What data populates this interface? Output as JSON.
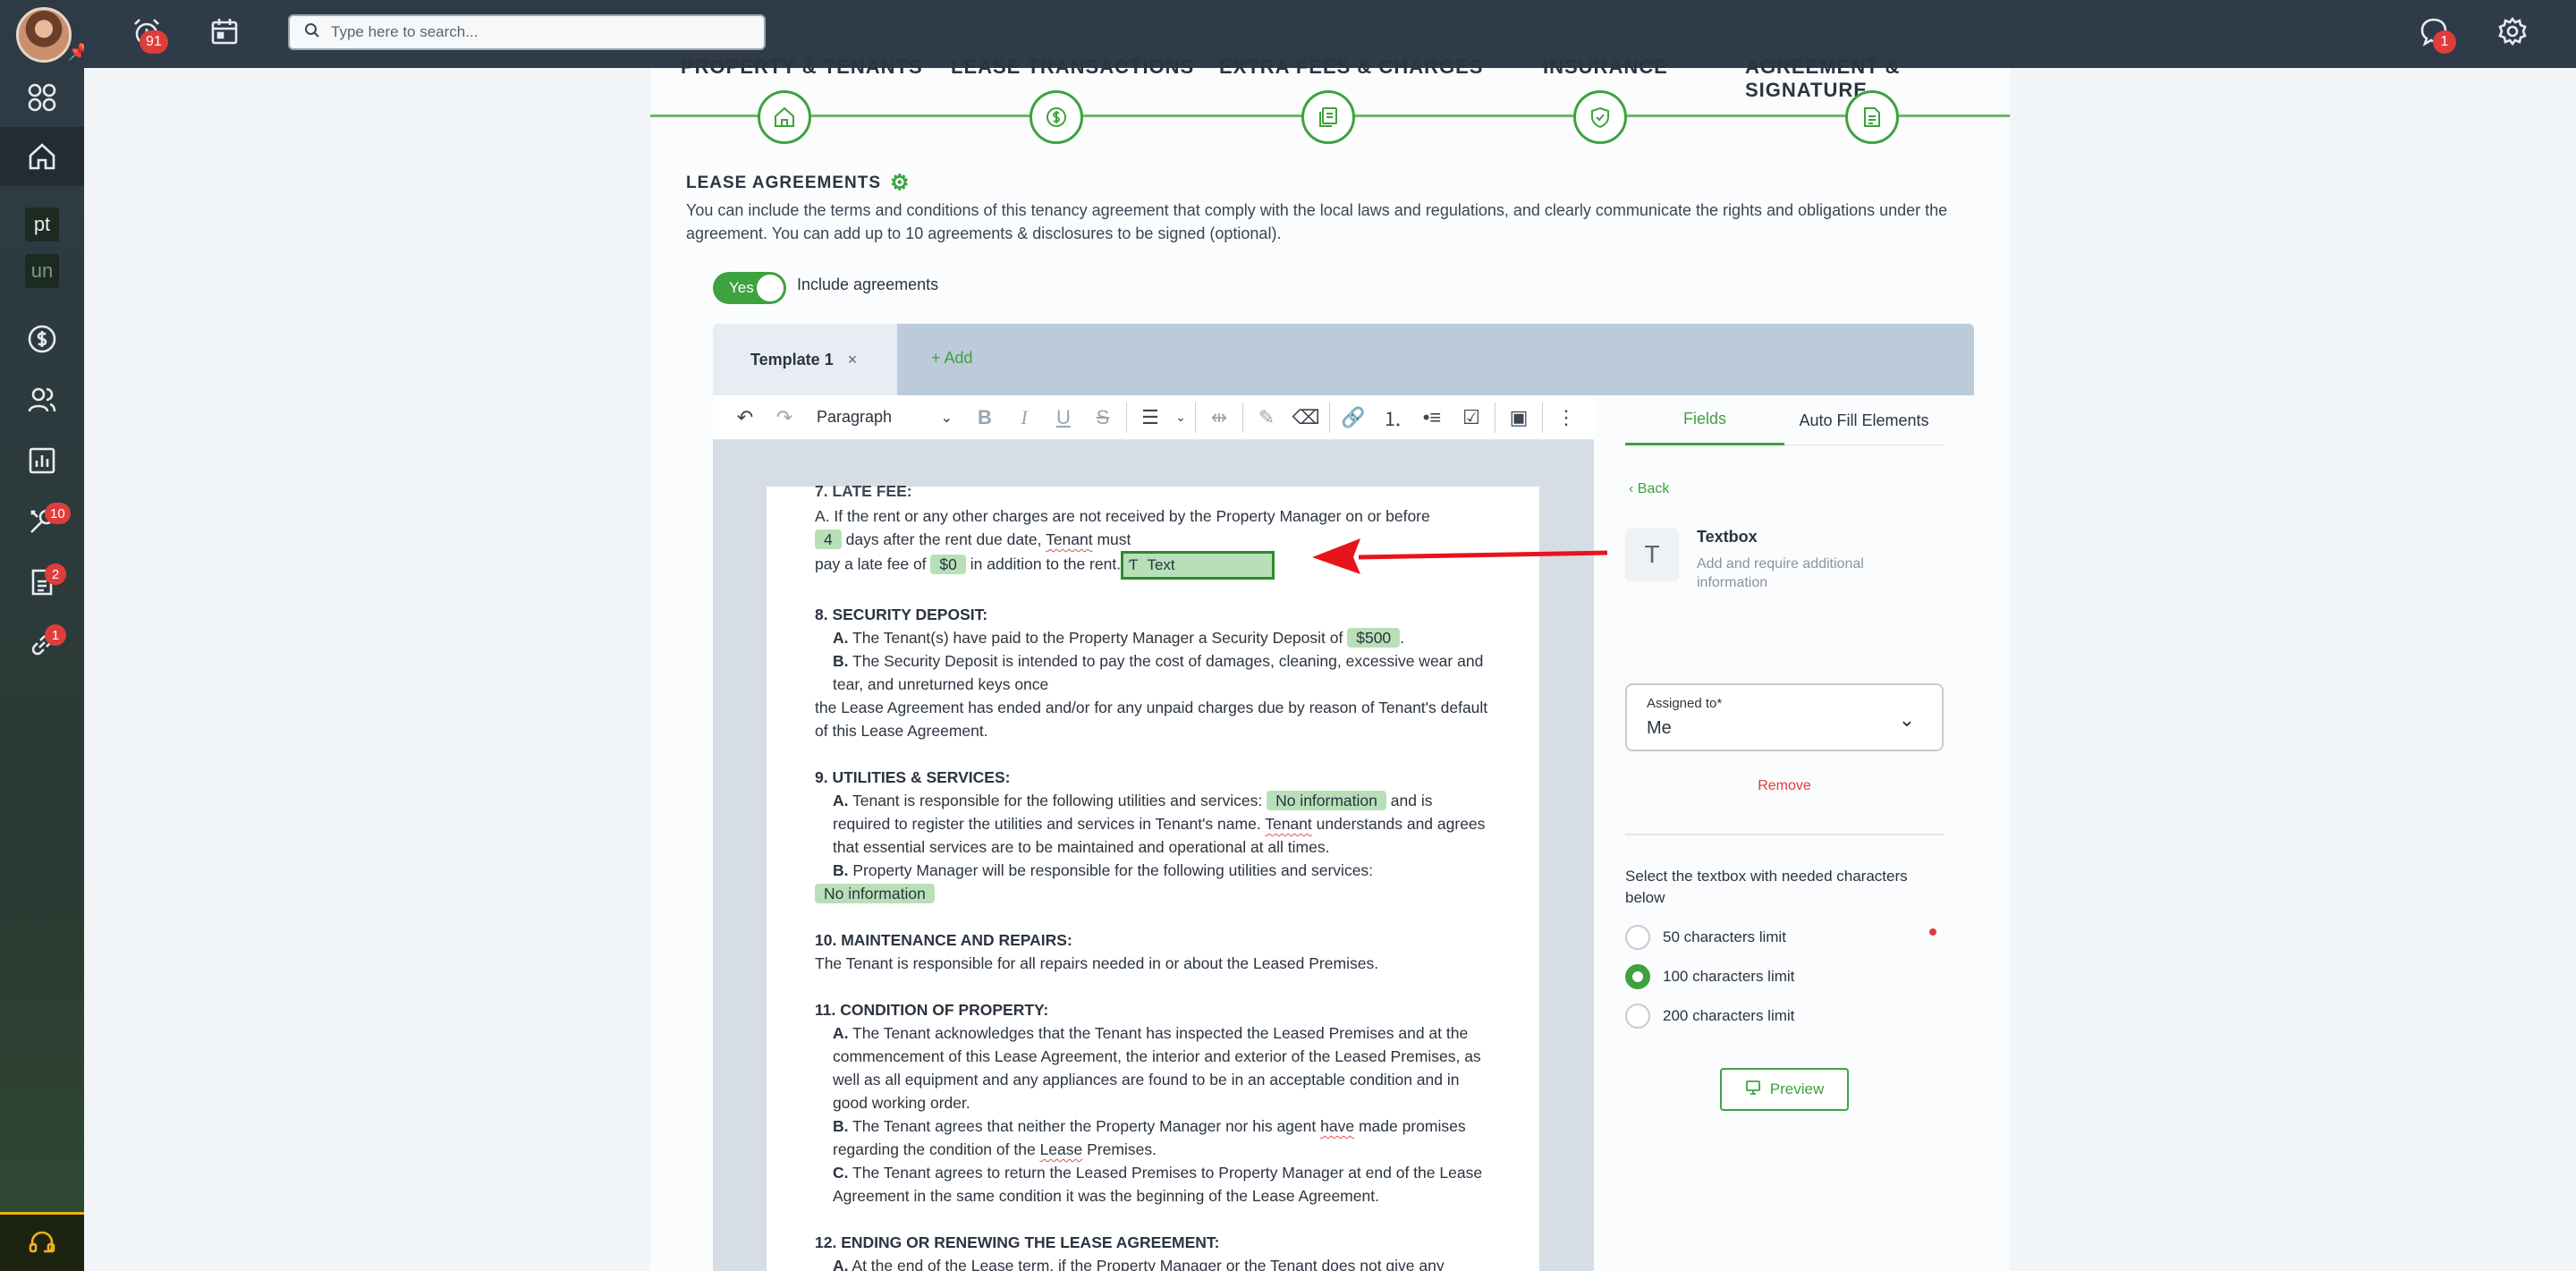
{
  "topbar": {
    "alarm_badge": "91",
    "search_placeholder": "Type here to search...",
    "chat_badge": "1"
  },
  "sidebar": {
    "square_items": [
      "pt",
      "un"
    ],
    "badges": {
      "maintenance": "10",
      "documents": "2",
      "links": "1"
    }
  },
  "stepper": {
    "labels": [
      "PROPERTY & TENANTS",
      "LEASE TRANSACTIONS",
      "EXTRA FEES & CHARGES",
      "INSURANCE",
      "AGREEMENT & SIGNATURE"
    ],
    "icons": [
      "home-icon",
      "dollar-icon",
      "copy-docs-icon",
      "shield-check-icon",
      "document-icon"
    ]
  },
  "section": {
    "title": "LEASE AGREEMENTS",
    "description": "You can include the terms and conditions of this tenancy agreement that comply with the local laws and regulations, and clearly communicate the rights and obligations under the agreement. You can add up to 10 agreements & disclosures to be signed (optional).",
    "toggle_label": "Yes",
    "include_label": "Include agreements"
  },
  "tabs": {
    "template_label": "Template 1",
    "close_glyph": "×",
    "add_label": "+ Add"
  },
  "toolbar": {
    "paragraph_label": "Paragraph"
  },
  "doc": {
    "clipped_heading": "7. LATE FEE:",
    "late_fee_a1": "A. If the rent or any other charges are not received by the Property Manager on or before",
    "late_days": "4",
    "late_fee_a2": "days after the rent due date,",
    "tenant_word": "Tenant",
    "must_word": "must",
    "pay_late": "pay a late fee of",
    "late_amount": "$0",
    "in_addition": "in addition to the rent.",
    "text_field_label": "Text",
    "security_head": "8. SECURITY DEPOSIT:",
    "security_a_pre": "The Tenant(s) have paid to the Property Manager a Security Deposit of",
    "security_amount": "$500",
    "security_b": "The Security Deposit is intended to pay the cost of damages, cleaning, excessive wear and tear, and unreturned keys once",
    "security_b2": "the Lease Agreement has ended and/or for any unpaid charges due by reason of Tenant's default of this Lease Agreement.",
    "utilities_head": "9. UTILITIES & SERVICES:",
    "utilities_a_pre": "Tenant is responsible for the following utilities and services:",
    "no_info": "No information",
    "utilities_a_post1": "and is required to register the utilities and services in Tenant's name.",
    "utilities_a_post2": "understands and agrees that essential services are to be maintained and operational at all times.",
    "utilities_b": "Property Manager will be responsible for the following utilities and services:",
    "maint_head": "10. MAINTENANCE AND REPAIRS:",
    "maint_text": "The Tenant is responsible for all repairs needed in or about the Leased Premises.",
    "cond_head": "11. CONDITION OF PROPERTY:",
    "cond_a": "The Tenant acknowledges that the Tenant has inspected the Leased Premises and at the commencement of this Lease Agreement, the interior and exterior of the Leased Premises, as well as all equipment and any appliances are found to be in an acceptable condition and in good working order.",
    "cond_b1": "The Tenant agrees that neither the Property Manager nor his agent",
    "have_word": "have",
    "cond_b2": "made promises regarding the condition of the",
    "lease_word": "Lease",
    "cond_b3": "Premises.",
    "cond_c": "The Tenant agrees to return the Leased Premises to Property Manager at end of the Lease Agreement in the same condition it was the beginning of the Lease Agreement.",
    "end_head": "12. ENDING OR RENEWING THE LEASE AGREEMENT:",
    "end_a1": "At the end of the",
    "end_a2": "term, if the Property Manager or the Tenant does not give any",
    "mark_a": "A.",
    "mark_b": "B.",
    "mark_c": "C."
  },
  "panel": {
    "tab_fields": "Fields",
    "tab_auto": "Auto Fill Elements",
    "back": "Back",
    "textbox_glyph": "T",
    "textbox_title": "Textbox",
    "textbox_desc": "Add and require additional information",
    "assigned_label": "Assigned to*",
    "assigned_value": "Me",
    "remove": "Remove",
    "select_text": "Select the textbox with needed characters below",
    "options": [
      "50 characters limit",
      "100 characters limit",
      "200 characters limit"
    ],
    "selected_option": 1,
    "preview": "Preview"
  },
  "colors": {
    "accent": "#3ea23e",
    "badge": "#e03c3c",
    "arrow": "#e8141c"
  }
}
